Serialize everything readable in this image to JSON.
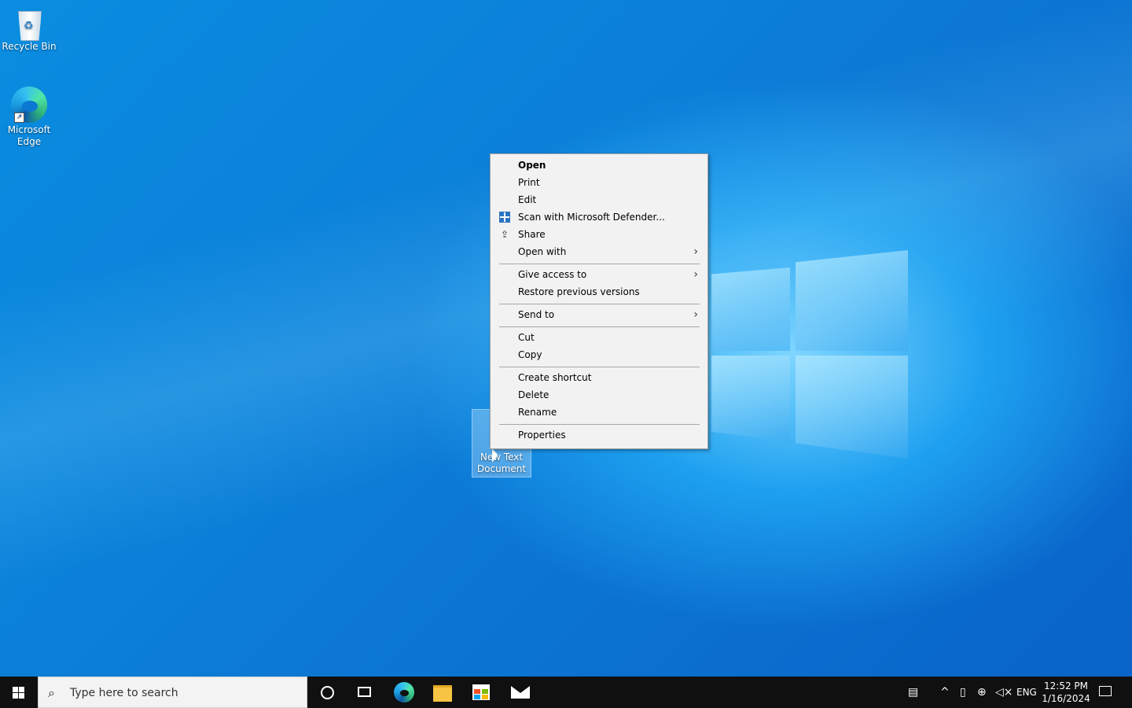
{
  "desktop": {
    "icons": [
      {
        "label": "Recycle Bin"
      },
      {
        "label": "Microsoft Edge"
      },
      {
        "label": "New Text Document"
      }
    ]
  },
  "context_menu": {
    "items": [
      {
        "label": "Open",
        "bold": true
      },
      {
        "label": "Print"
      },
      {
        "label": "Edit"
      },
      {
        "label": "Scan with Microsoft Defender...",
        "icon": "defender-icon"
      },
      {
        "label": "Share",
        "icon": "share-icon"
      },
      {
        "label": "Open with",
        "submenu": true
      },
      {
        "label": "Give access to",
        "submenu": true
      },
      {
        "label": "Restore previous versions"
      },
      {
        "label": "Send to",
        "submenu": true
      },
      {
        "label": "Cut"
      },
      {
        "label": "Copy"
      },
      {
        "label": "Create shortcut"
      },
      {
        "label": "Delete"
      },
      {
        "label": "Rename"
      },
      {
        "label": "Properties"
      }
    ],
    "submenu_arrow": "›"
  },
  "taskbar": {
    "search_placeholder": "Type here to search",
    "language": "ENG",
    "time": "12:52 PM",
    "date": "1/16/2024"
  },
  "colors": {
    "taskbar_bg": "#101010",
    "menu_bg": "#f2f2f2",
    "desktop_accent": "#0078d7"
  }
}
